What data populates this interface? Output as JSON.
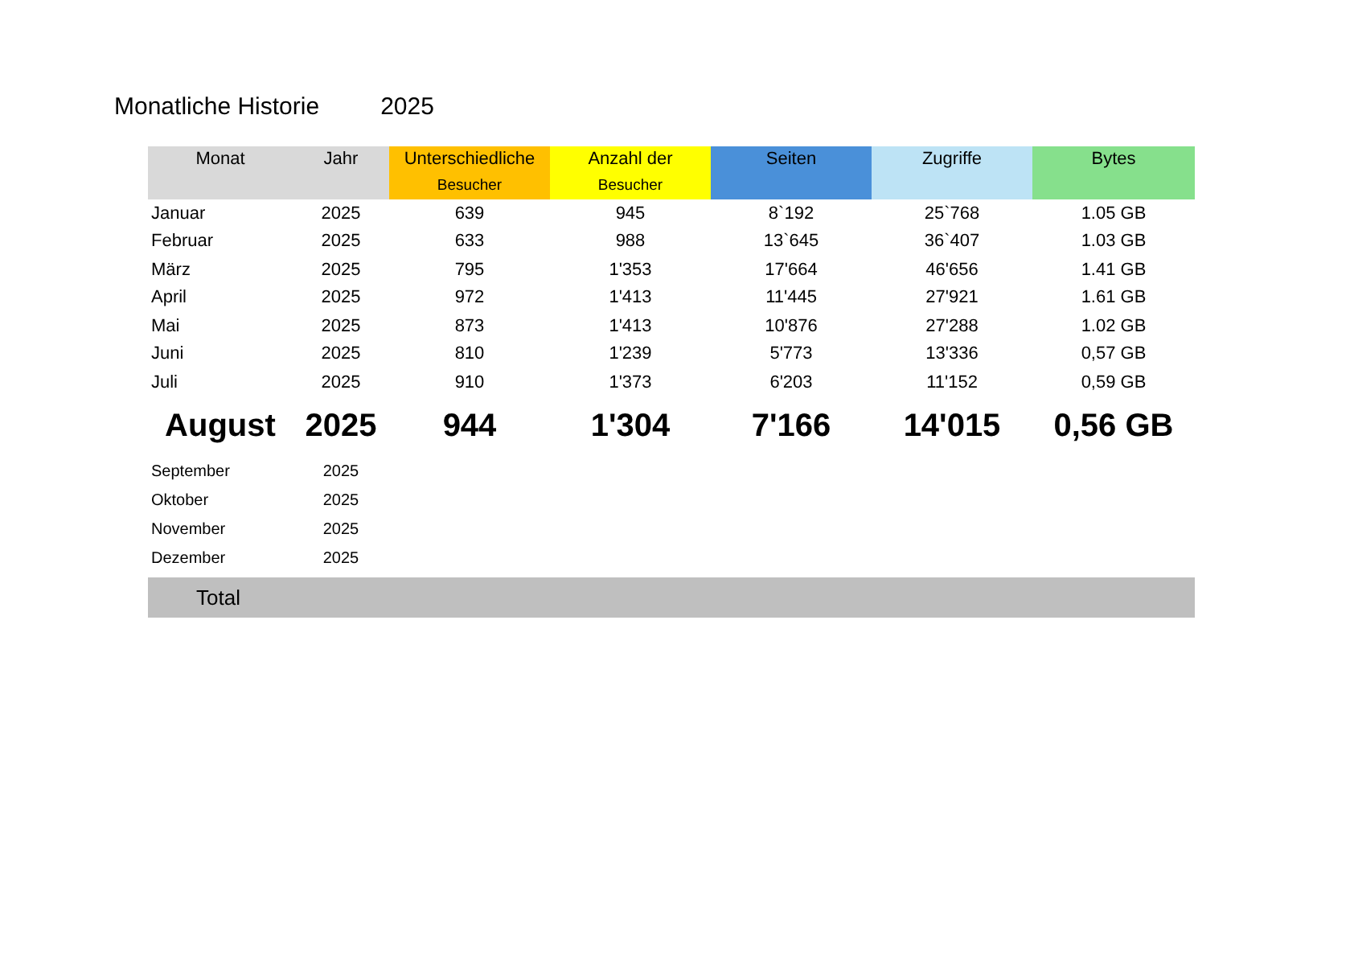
{
  "title": "Monatliche Historie",
  "year": "2025",
  "columns": [
    {
      "label": "Monat",
      "color": "#d9d9d9"
    },
    {
      "label": "Jahr",
      "color": "#d9d9d9"
    },
    {
      "label": "Unterschiedliche",
      "label_2": "Besucher",
      "color": "#ffc000"
    },
    {
      "label": "Anzahl der",
      "label_2": "Besucher",
      "color": "#ffff00"
    },
    {
      "label": "Seiten",
      "color": "#4a90d9"
    },
    {
      "label": "Zugriffe",
      "color": "#bde3f5"
    },
    {
      "label": "Bytes",
      "color": "#86e08c"
    }
  ],
  "rows": [
    {
      "kind": "past",
      "cells": [
        "Januar",
        "2025",
        "639",
        "945",
        "8`192",
        "25`768",
        "1.05 GB"
      ]
    },
    {
      "kind": "past",
      "cells": [
        "Februar",
        "2025",
        "633",
        "988",
        "13`645",
        "36`407",
        "1.03 GB"
      ]
    },
    {
      "kind": "past",
      "cells": [
        "März",
        "2025",
        "795",
        "1'353",
        "17'664",
        "46'656",
        "1.41 GB"
      ]
    },
    {
      "kind": "past",
      "cells": [
        "April",
        "2025",
        "972",
        "1'413",
        "11'445",
        "27'921",
        "1.61 GB"
      ]
    },
    {
      "kind": "past",
      "cells": [
        "Mai",
        "2025",
        "873",
        "1'413",
        "10'876",
        "27'288",
        "1.02 GB"
      ]
    },
    {
      "kind": "past",
      "cells": [
        "Juni",
        "2025",
        "810",
        "1'239",
        "5'773",
        "13'336",
        "0,57 GB"
      ]
    },
    {
      "kind": "past",
      "cells": [
        "Juli",
        "2025",
        "910",
        "1'373",
        "6'203",
        "11'152",
        "0,59 GB"
      ]
    },
    {
      "kind": "current",
      "cells": [
        "August",
        "2025",
        "944",
        "1'304",
        "7'166",
        "14'015",
        "0,56 GB"
      ]
    },
    {
      "kind": "future",
      "cells": [
        "September",
        "2025"
      ]
    },
    {
      "kind": "future",
      "cells": [
        "Oktober",
        "2025"
      ]
    },
    {
      "kind": "future",
      "cells": [
        "November",
        "2025"
      ]
    },
    {
      "kind": "future",
      "cells": [
        "Dezember",
        "2025"
      ]
    }
  ],
  "total": {
    "label": "Total"
  }
}
